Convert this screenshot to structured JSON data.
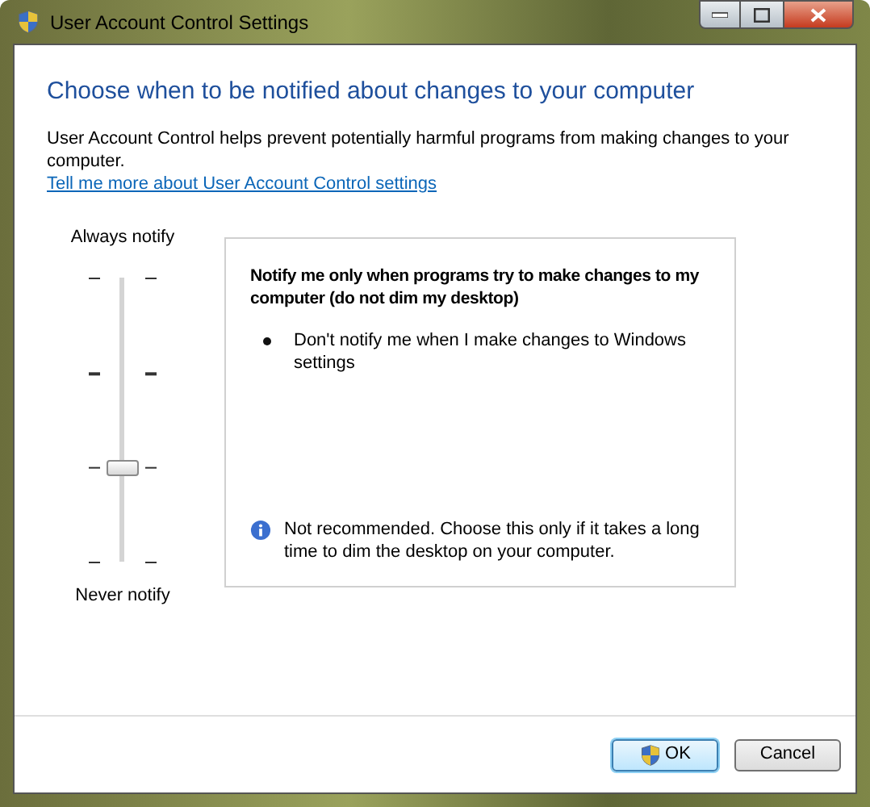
{
  "window": {
    "title": "User Account Control Settings"
  },
  "heading": "Choose when to be notified about changes to your computer",
  "description": "User Account Control helps prevent potentially harmful programs from making changes to your computer.",
  "link": "Tell me more about User Account Control settings",
  "slider": {
    "top_label": "Always notify",
    "bottom_label": "Never notify",
    "level": 0.333
  },
  "panel": {
    "title": "Notify me only when programs try to make changes to my computer (do not dim my desktop)",
    "bullets": [
      "Don't notify me when I make changes to Windows settings"
    ],
    "note": "Not recommended. Choose this only if it takes a long time to dim the desktop on your computer."
  },
  "buttons": [
    {
      "label": "OK",
      "kind": "shield",
      "default": true
    },
    {
      "label": "Cancel",
      "kind": "plain",
      "default": false
    }
  ]
}
